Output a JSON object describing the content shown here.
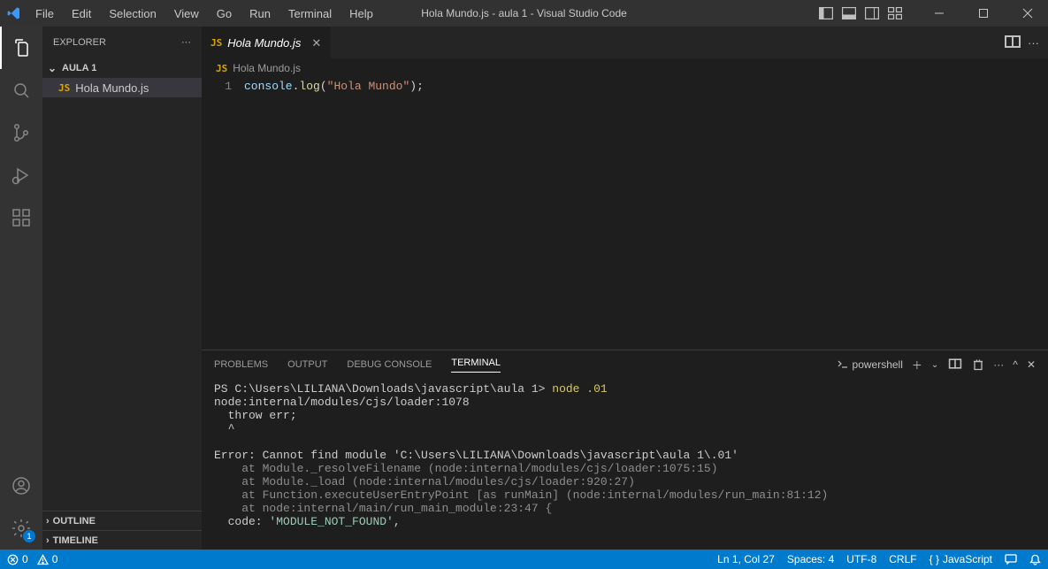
{
  "titlebar": {
    "menu": [
      "File",
      "Edit",
      "Selection",
      "View",
      "Go",
      "Run",
      "Terminal",
      "Help"
    ],
    "title": "Hola Mundo.js - aula 1 - Visual Studio Code"
  },
  "sidebar": {
    "title": "EXPLORER",
    "folder": "AULA 1",
    "items": [
      {
        "icon": "JS",
        "label": "Hola Mundo.js"
      }
    ],
    "outline": "OUTLINE",
    "timeline": "TIMELINE"
  },
  "tab": {
    "icon": "JS",
    "label": "Hola Mundo.js"
  },
  "breadcrumb": {
    "icon": "JS",
    "label": "Hola Mundo.js"
  },
  "editor": {
    "line_number": "1",
    "tokens": {
      "obj": "console",
      "dot": ".",
      "fn": "log",
      "lp": "(",
      "str": "\"Hola Mundo\"",
      "rp": ")",
      "semi": ";"
    }
  },
  "panel": {
    "tabs": {
      "problems": "PROBLEMS",
      "output": "OUTPUT",
      "debug": "DEBUG CONSOLE",
      "terminal": "TERMINAL"
    },
    "profile": "powershell",
    "prompt_prefix": "PS C:\\Users\\LILIANA\\Downloads\\javascript\\aula 1> ",
    "prompt_cmd": "node .01",
    "lines": [
      "node:internal/modules/cjs/loader:1078",
      "  throw err;",
      "  ^",
      "",
      "Error: Cannot find module 'C:\\Users\\LILIANA\\Downloads\\javascript\\aula 1\\.01'",
      "    at Module._resolveFilename (node:internal/modules/cjs/loader:1075:15)",
      "    at Module._load (node:internal/modules/cjs/loader:920:27)",
      "    at Function.executeUserEntryPoint [as runMain] (node:internal/modules/run_main:81:12)",
      "    at node:internal/main/run_main_module:23:47 {"
    ],
    "code_label": "  code: ",
    "code_value": "'MODULE_NOT_FOUND'",
    "code_tail": ","
  },
  "statusbar": {
    "errors": "0",
    "warnings": "0",
    "ln_col": "Ln 1, Col 27",
    "spaces": "Spaces: 4",
    "encoding": "UTF-8",
    "eol": "CRLF",
    "language": "JavaScript"
  },
  "activitybar": {
    "badge": "1"
  }
}
